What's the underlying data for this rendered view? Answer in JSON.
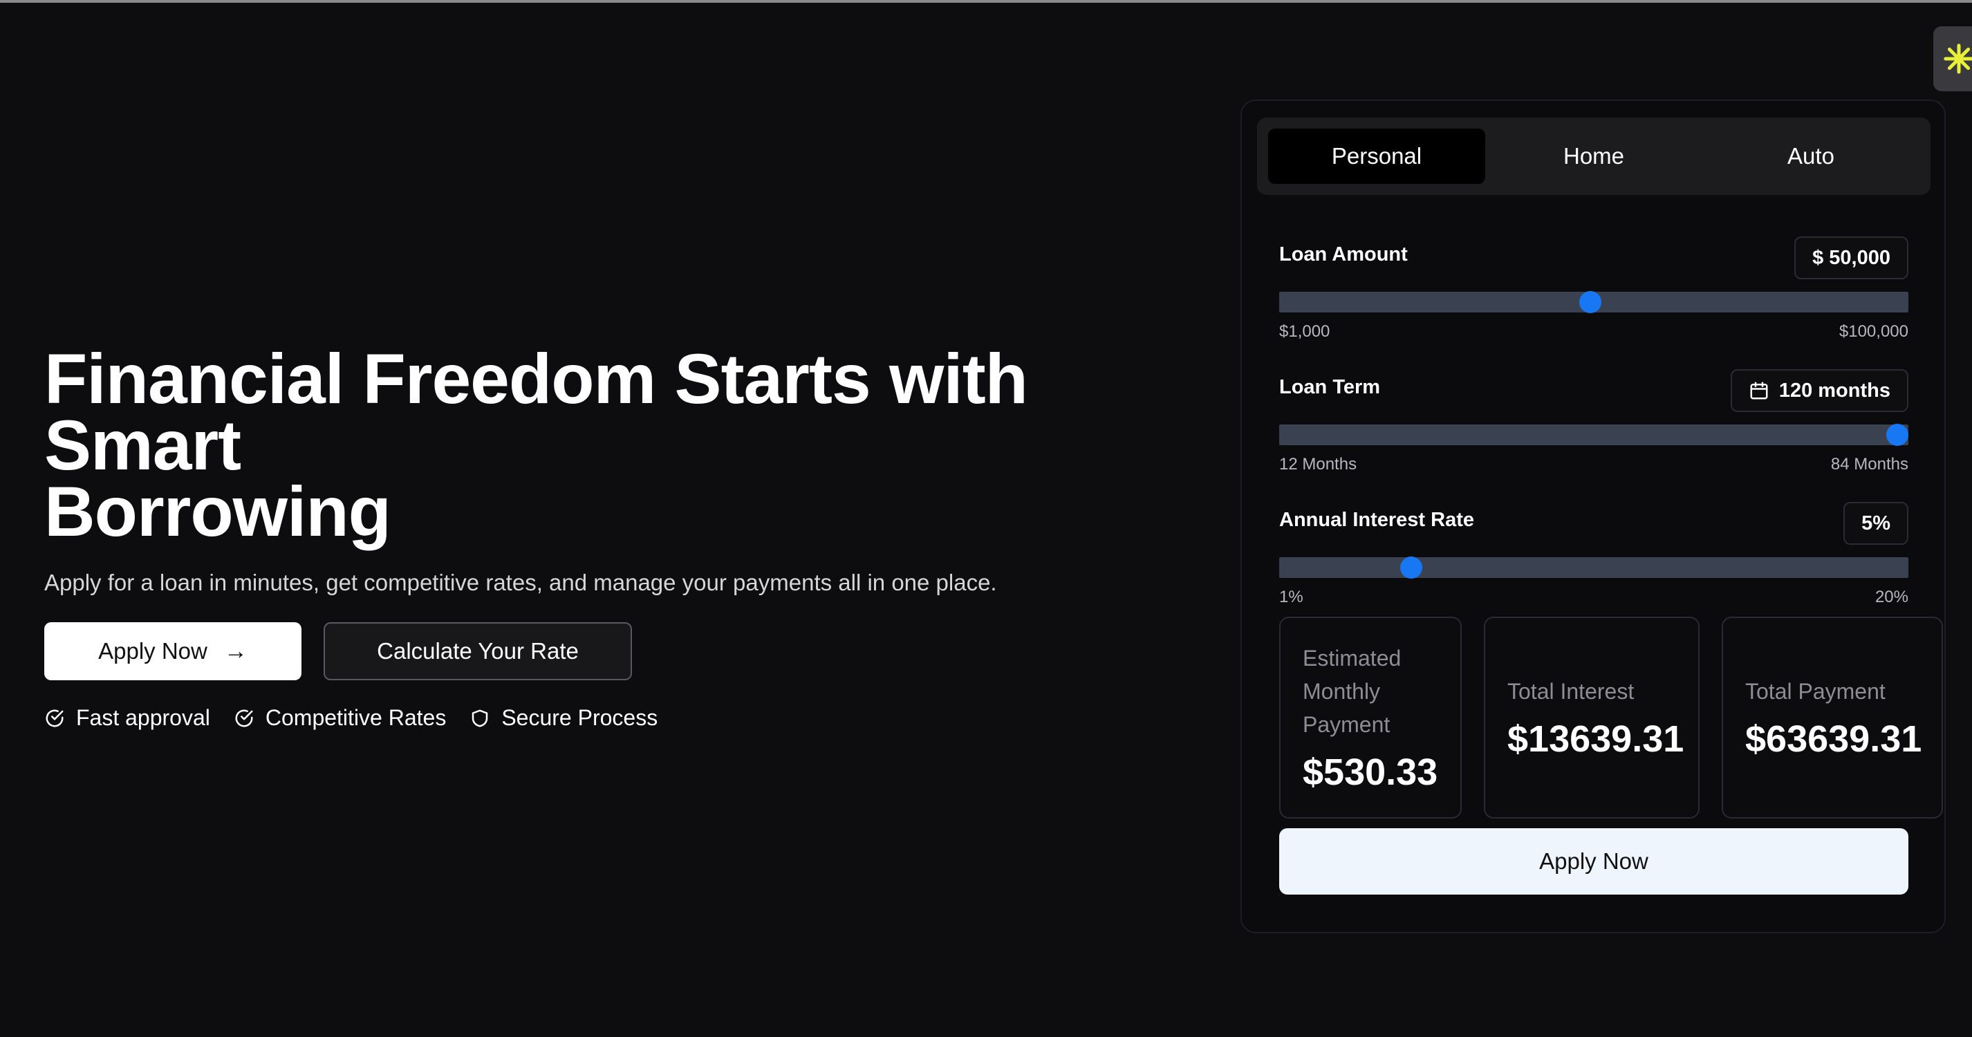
{
  "hero": {
    "title_line1": "Financial Freedom Starts with Smart",
    "title_line2": "Borrowing",
    "subtitle": "Apply for a loan in minutes, get competitive rates, and manage your payments all in one place.",
    "apply_label": "Apply Now",
    "apply_arrow": "→",
    "calculate_label": "Calculate Your Rate",
    "features": [
      {
        "label": "Fast approval",
        "icon": "check-circle-icon"
      },
      {
        "label": "Competitive Rates",
        "icon": "check-circle-icon"
      },
      {
        "label": "Secure Process",
        "icon": "shield-icon"
      }
    ]
  },
  "calculator": {
    "tabs": [
      "Personal",
      "Home",
      "Auto"
    ],
    "active_tab": "Personal",
    "loan_amount": {
      "label": "Loan Amount",
      "value": "$ 50,000",
      "min": "$1,000",
      "max": "$100,000",
      "level": 0.495
    },
    "loan_term": {
      "label": "Loan Term",
      "value": "120 months",
      "icon": "calendar-icon",
      "min": "12 Months",
      "max": "84 Months",
      "level": 1.0
    },
    "interest_rate": {
      "label": "Annual Interest Rate",
      "value": "5%",
      "min": "1%",
      "max": "20%",
      "level": 0.21
    },
    "results": {
      "monthly_label_1": "Estimated",
      "monthly_label_2": "Monthly",
      "monthly_label_3": "Payment",
      "monthly_value": "$530.33",
      "interest_label": "Total Interest",
      "interest_value": "$13639.31",
      "payment_label": "Total Payment",
      "payment_value": "$63639.31"
    },
    "apply_label": "Apply Now"
  },
  "colors": {
    "background": "#0d0d0f",
    "accent": "#1877f2",
    "track": "#3a4150",
    "widget_icon": "#e8f03a"
  }
}
